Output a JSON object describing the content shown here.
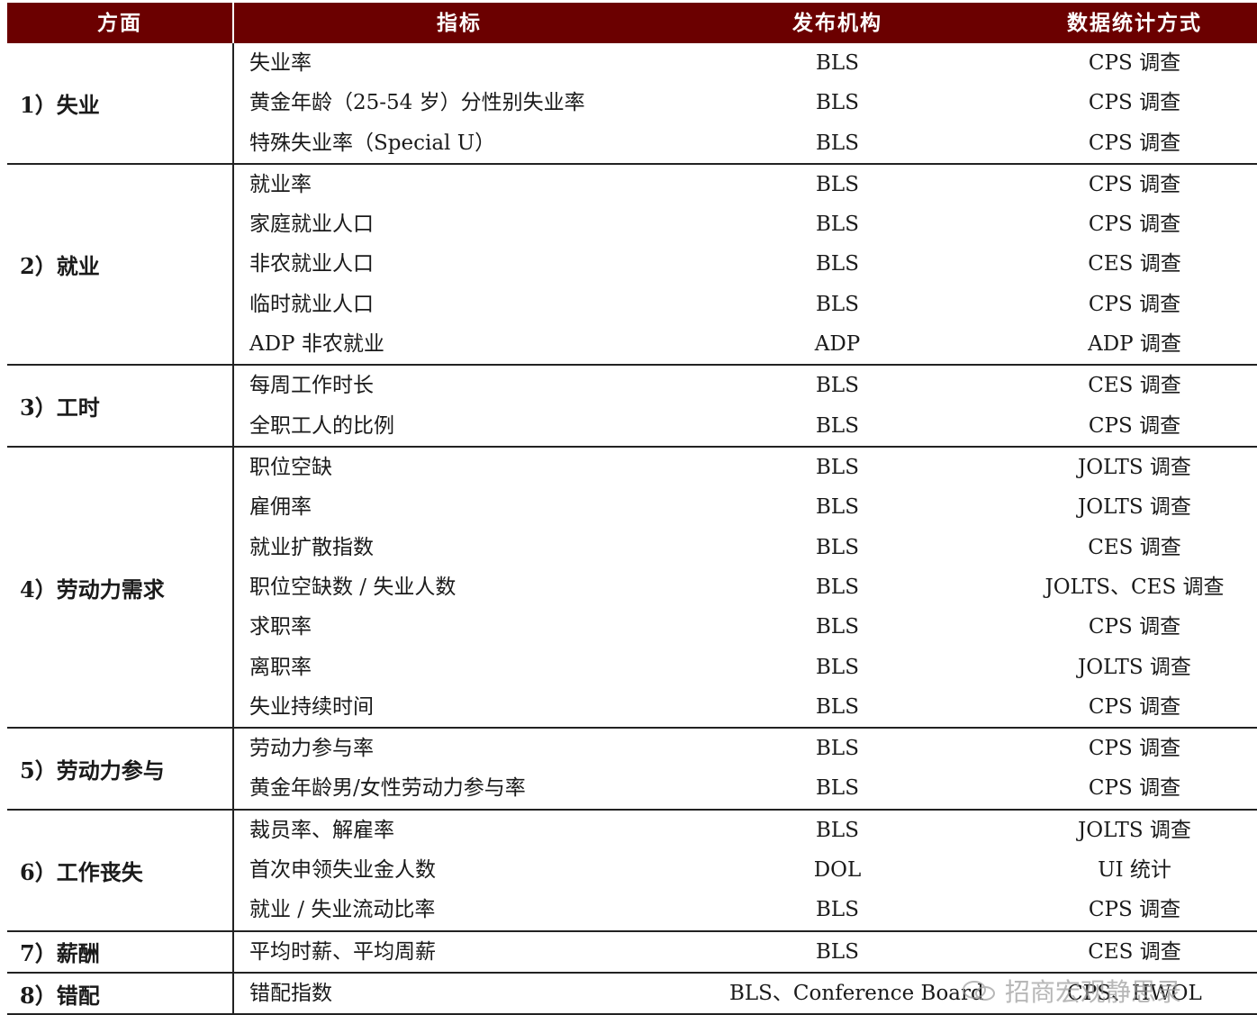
{
  "headers": {
    "aspect": "方面",
    "indicator": "指标",
    "publisher": "发布机构",
    "method": "数据统计方式"
  },
  "colors": {
    "header_bg": "#6b0000",
    "header_text": "#ffffff"
  },
  "groups": [
    {
      "aspect": "1）失业",
      "rows": [
        {
          "indicator": "失业率",
          "publisher": "BLS",
          "method": "CPS 调查"
        },
        {
          "indicator": "黄金年龄（25-54 岁）分性别失业率",
          "publisher": "BLS",
          "method": "CPS 调查"
        },
        {
          "indicator": "特殊失业率（Special U）",
          "publisher": "BLS",
          "method": "CPS 调查"
        }
      ]
    },
    {
      "aspect": "2）就业",
      "rows": [
        {
          "indicator": "就业率",
          "publisher": "BLS",
          "method": "CPS 调查"
        },
        {
          "indicator": "家庭就业人口",
          "publisher": "BLS",
          "method": "CPS 调查"
        },
        {
          "indicator": "非农就业人口",
          "publisher": "BLS",
          "method": "CES 调查"
        },
        {
          "indicator": "临时就业人口",
          "publisher": "BLS",
          "method": "CPS 调查"
        },
        {
          "indicator": "ADP 非农就业",
          "publisher": "ADP",
          "method": "ADP 调查"
        }
      ]
    },
    {
      "aspect": "3）工时",
      "rows": [
        {
          "indicator": "每周工作时长",
          "publisher": "BLS",
          "method": "CES 调查"
        },
        {
          "indicator": "全职工人的比例",
          "publisher": "BLS",
          "method": "CPS 调查"
        }
      ]
    },
    {
      "aspect": "4）劳动力需求",
      "rows": [
        {
          "indicator": "职位空缺",
          "publisher": "BLS",
          "method": "JOLTS 调查"
        },
        {
          "indicator": "雇佣率",
          "publisher": "BLS",
          "method": "JOLTS 调查"
        },
        {
          "indicator": "就业扩散指数",
          "publisher": "BLS",
          "method": "CES 调查"
        },
        {
          "indicator": "职位空缺数 / 失业人数",
          "publisher": "BLS",
          "method": "JOLTS、CES 调查"
        },
        {
          "indicator": "求职率",
          "publisher": "BLS",
          "method": "CPS 调查"
        },
        {
          "indicator": "离职率",
          "publisher": "BLS",
          "method": "JOLTS 调查"
        },
        {
          "indicator": "失业持续时间",
          "publisher": "BLS",
          "method": "CPS 调查"
        }
      ]
    },
    {
      "aspect": "5）劳动力参与",
      "rows": [
        {
          "indicator": "劳动力参与率",
          "publisher": "BLS",
          "method": "CPS 调查"
        },
        {
          "indicator": "黄金年龄男/女性劳动力参与率",
          "publisher": "BLS",
          "method": "CPS 调查"
        }
      ]
    },
    {
      "aspect": "6）工作丧失",
      "rows": [
        {
          "indicator": "裁员率、解雇率",
          "publisher": "BLS",
          "method": "JOLTS 调查"
        },
        {
          "indicator": "首次申领失业金人数",
          "publisher": "DOL",
          "method": "UI 统计"
        },
        {
          "indicator": "就业 / 失业流动比率",
          "publisher": "BLS",
          "method": "CPS 调查"
        }
      ]
    },
    {
      "aspect": "7）薪酬",
      "rows": [
        {
          "indicator": "平均时薪、平均周薪",
          "publisher": "BLS",
          "method": "CES 调查"
        }
      ]
    },
    {
      "aspect": "8）错配",
      "rows": [
        {
          "indicator": "错配指数",
          "publisher": "BLS、Conference Board",
          "method": "CPS、HWOL"
        }
      ]
    }
  ],
  "watermark": "招商宏观静思录"
}
